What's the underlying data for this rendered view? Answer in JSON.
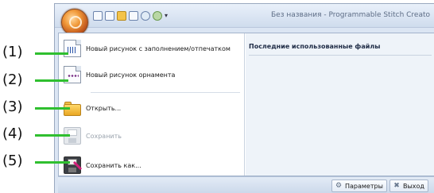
{
  "window": {
    "title": "Без названия - Programmable Stitch Creato"
  },
  "recent": {
    "title": "Последние использованные файлы"
  },
  "menu_items": [
    {
      "label": "Новый рисунок с заполнением/отпечатком",
      "enabled": true,
      "icon": "new-fill-pattern-icon"
    },
    {
      "label": "Новый рисунок орнамента",
      "enabled": true,
      "icon": "new-decorative-pattern-icon"
    },
    {
      "label": "Открыть...",
      "enabled": true,
      "icon": "folder-open-icon"
    },
    {
      "label": "Сохранить",
      "enabled": false,
      "icon": "save-disk-icon"
    },
    {
      "label": "Сохранить как...",
      "enabled": true,
      "icon": "save-as-icon"
    }
  ],
  "callouts": [
    "(1)",
    "(2)",
    "(3)",
    "(4)",
    "(5)"
  ],
  "footer": {
    "options_label": "Параметры",
    "exit_label": "Выход"
  },
  "colors": {
    "callout_line": "#2fbf2f",
    "menu_bg": "#ffffff",
    "frame": "#dbe5f3"
  }
}
